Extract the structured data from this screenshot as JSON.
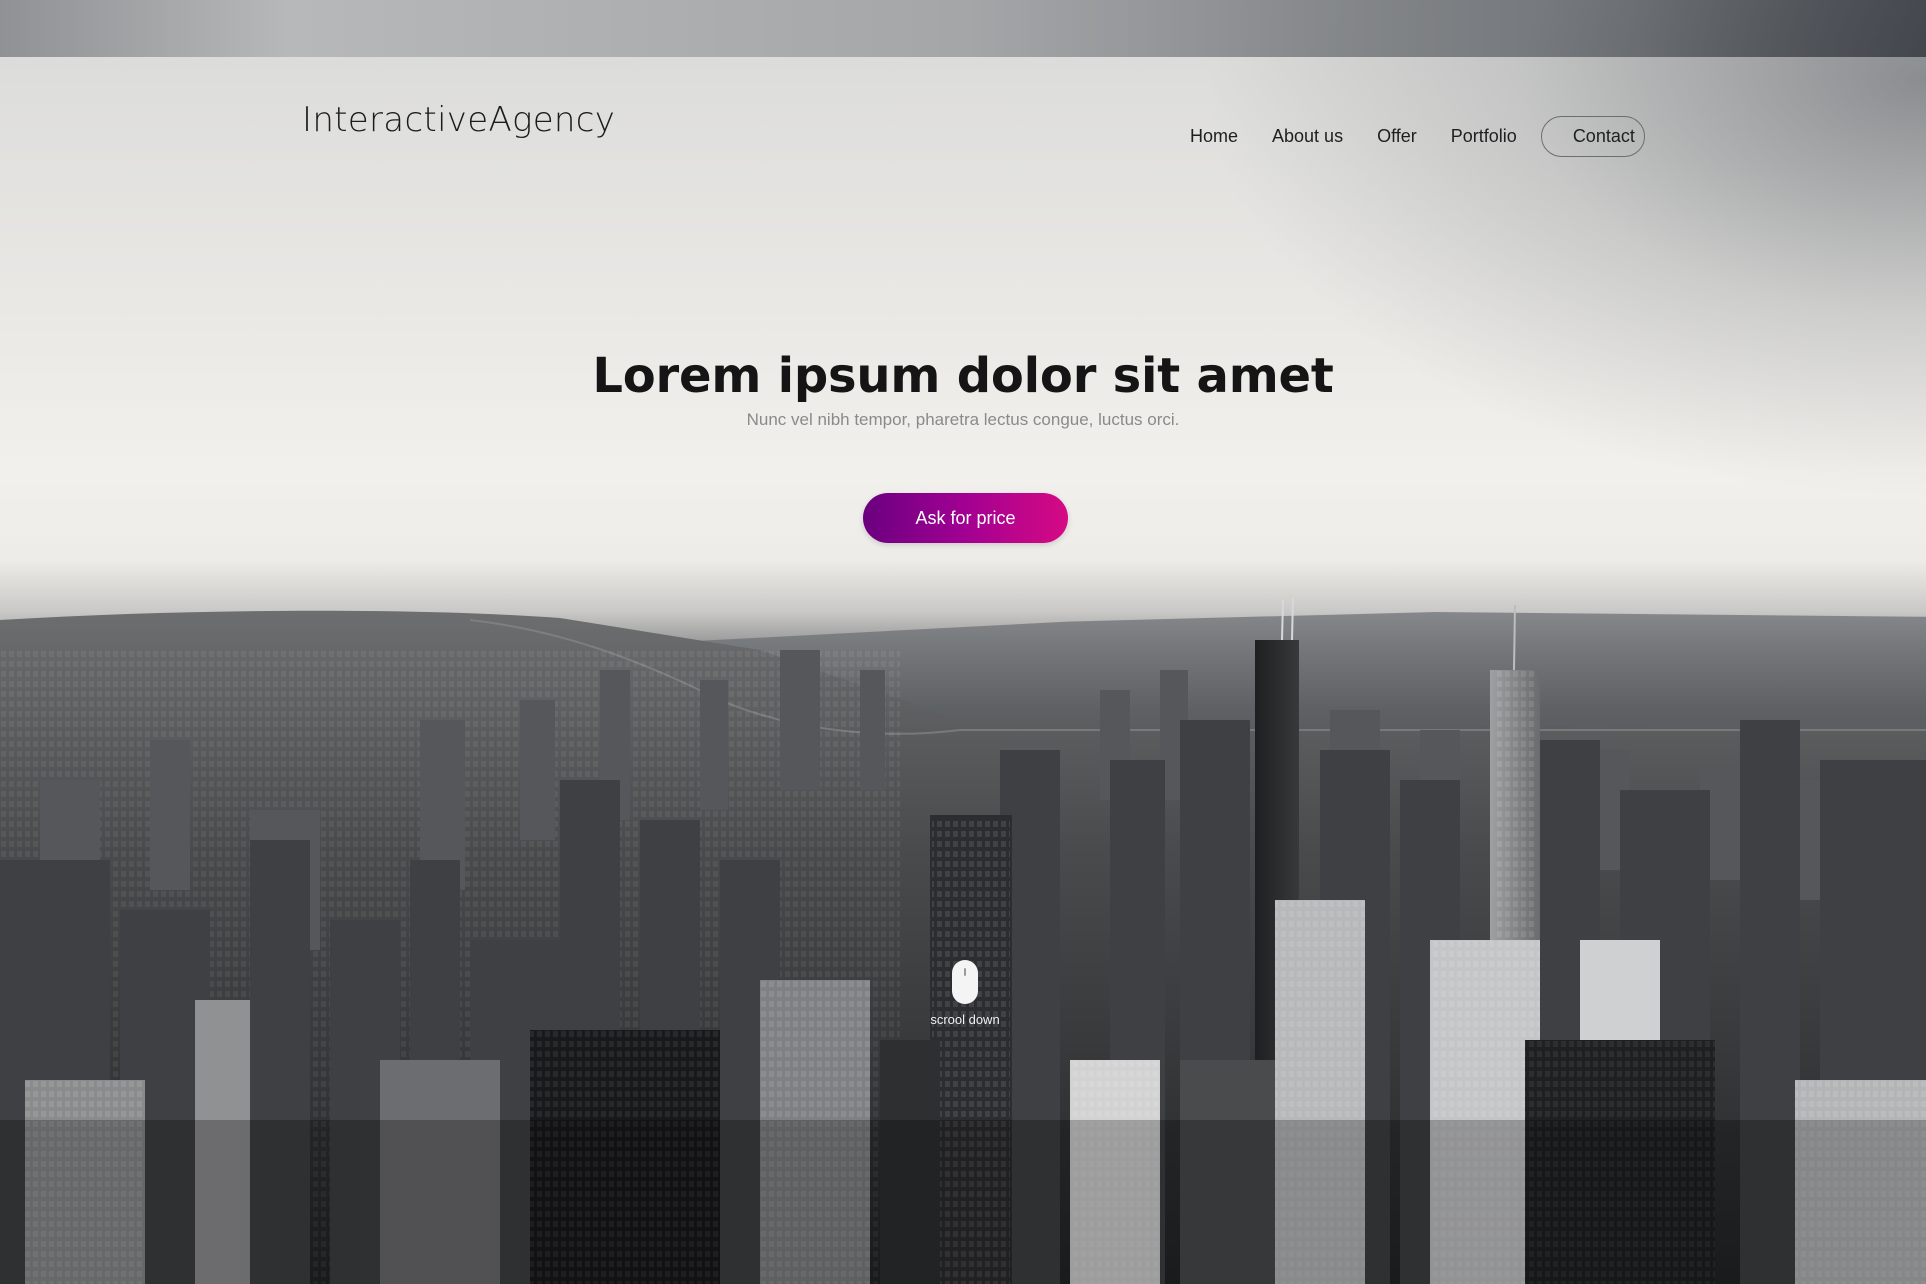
{
  "header": {
    "logo": "InteractiveAgency",
    "nav": [
      {
        "label": "Home"
      },
      {
        "label": "About us"
      },
      {
        "label": "Offer"
      },
      {
        "label": "Portfolio"
      },
      {
        "label": "Contact"
      }
    ]
  },
  "hero": {
    "title": "Lorem ipsum dolor sit amet",
    "subtitle": "Nunc vel nibh tempor, pharetra lectus congue, luctus orci.",
    "cta_label": "Ask for price",
    "scroll_label": "scrool down",
    "background": "aerial-city-skyline-image"
  },
  "colors": {
    "cta_start": "#6a007f",
    "cta_end": "#d60a84",
    "text_dark": "#151515",
    "text_muted": "#8a8a8a"
  }
}
